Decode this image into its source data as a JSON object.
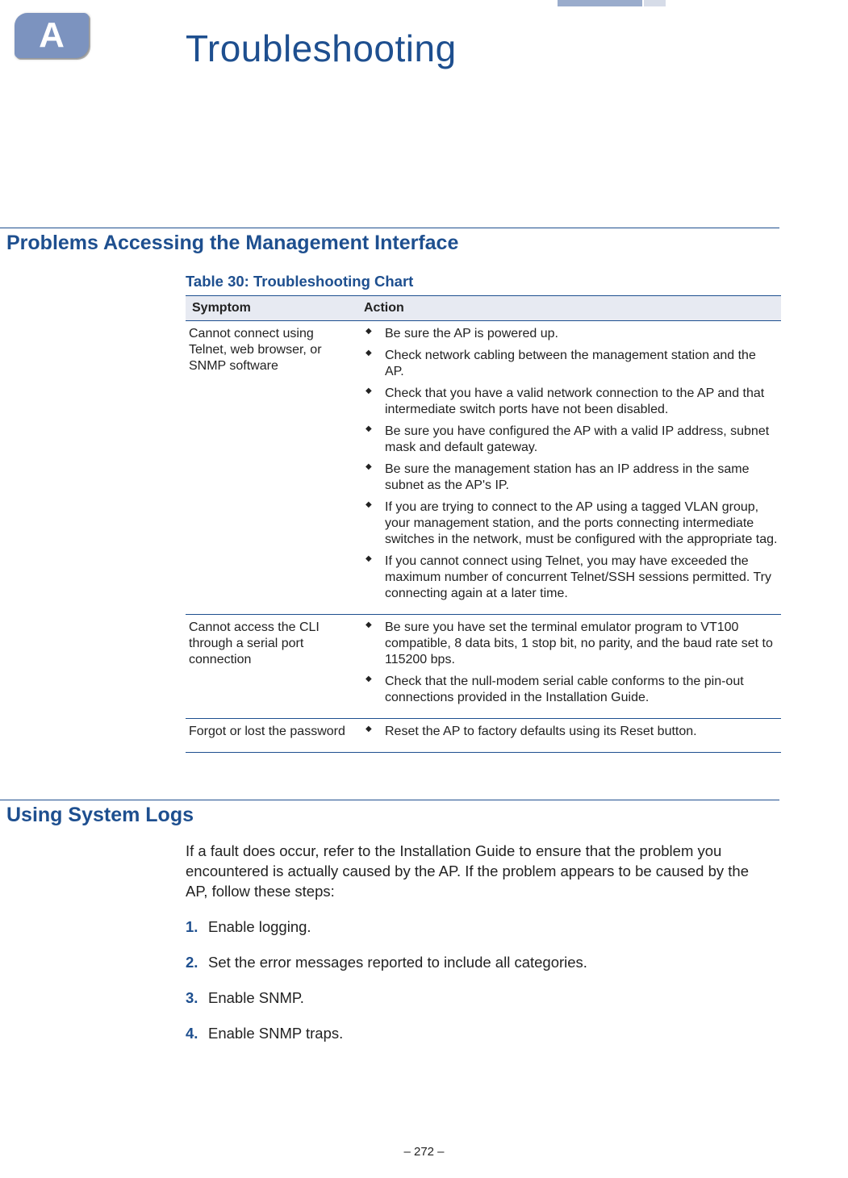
{
  "appendix_letter": "A",
  "title": "Troubleshooting",
  "section1": {
    "heading": "Problems Accessing the Management Interface",
    "table_title": "Table 30: Troubleshooting Chart",
    "columns": {
      "symptom": "Symptom",
      "action": "Action"
    },
    "rows": [
      {
        "symptom": "Cannot connect using Telnet, web browser, or SNMP software",
        "actions": [
          "Be sure the AP is powered up.",
          "Check network cabling between the management station and the AP.",
          "Check that you have a valid network connection to the AP and that intermediate switch ports have not been disabled.",
          "Be sure you have configured the AP with a valid IP address, subnet mask and default gateway.",
          "Be sure the management station has an IP address in the same subnet as the AP's IP.",
          "If you are trying to connect to the AP using a tagged VLAN group, your management station, and the ports connecting intermediate switches in the network, must be configured with the appropriate tag.",
          "If you cannot connect using Telnet, you may have exceeded the maximum number of concurrent Telnet/SSH sessions permitted. Try connecting again at a later time."
        ]
      },
      {
        "symptom": "Cannot access the CLI through a serial port connection",
        "actions": [
          "Be sure you have set the terminal emulator program to VT100 compatible, 8 data bits, 1 stop bit, no parity, and the baud rate set to 115200 bps.",
          "Check that the null-modem serial cable conforms to the pin-out connections provided in the Installation Guide."
        ]
      },
      {
        "symptom": "Forgot or lost the password",
        "actions": [
          "Reset the AP to factory defaults using its Reset button."
        ]
      }
    ]
  },
  "section2": {
    "heading": "Using System Logs",
    "intro": "If a fault does occur, refer to the Installation Guide to ensure that the problem you encountered is actually caused by the AP. If the problem appears to be caused by the AP, follow these steps:",
    "steps": [
      {
        "num": "1.",
        "text": "Enable logging."
      },
      {
        "num": "2.",
        "text": "Set the error messages reported to include all categories."
      },
      {
        "num": "3.",
        "text": "Enable SNMP."
      },
      {
        "num": "4.",
        "text": "Enable SNMP traps."
      }
    ]
  },
  "footer": "–  272  –"
}
